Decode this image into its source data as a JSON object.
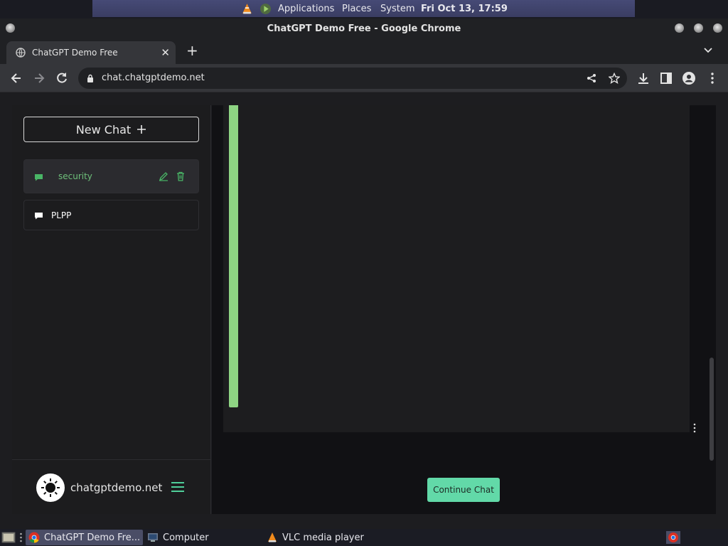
{
  "top_panel": {
    "menus": [
      "Applications",
      "Places",
      "System"
    ],
    "clock": "Fri Oct 13, 17:59"
  },
  "window": {
    "title": "ChatGPT Demo Free - Google Chrome"
  },
  "browser": {
    "tab_title": "ChatGPT Demo Free",
    "url": "chat.chatgptdemo.net"
  },
  "sidebar": {
    "new_chat_label": "New Chat",
    "chats": [
      {
        "label": "security",
        "active": true
      },
      {
        "label": "PLPP",
        "active": false
      }
    ],
    "brand": "chatgptdemo.net"
  },
  "main": {
    "continue_label": "Continue Chat"
  },
  "taskbar": {
    "items": [
      "ChatGPT Demo Fre...",
      "Computer",
      "VLC media player"
    ]
  },
  "colors": {
    "accent_green": "#62d9a8",
    "message_bar": "#8ed483",
    "active_chat_text": "#6ec07a"
  }
}
